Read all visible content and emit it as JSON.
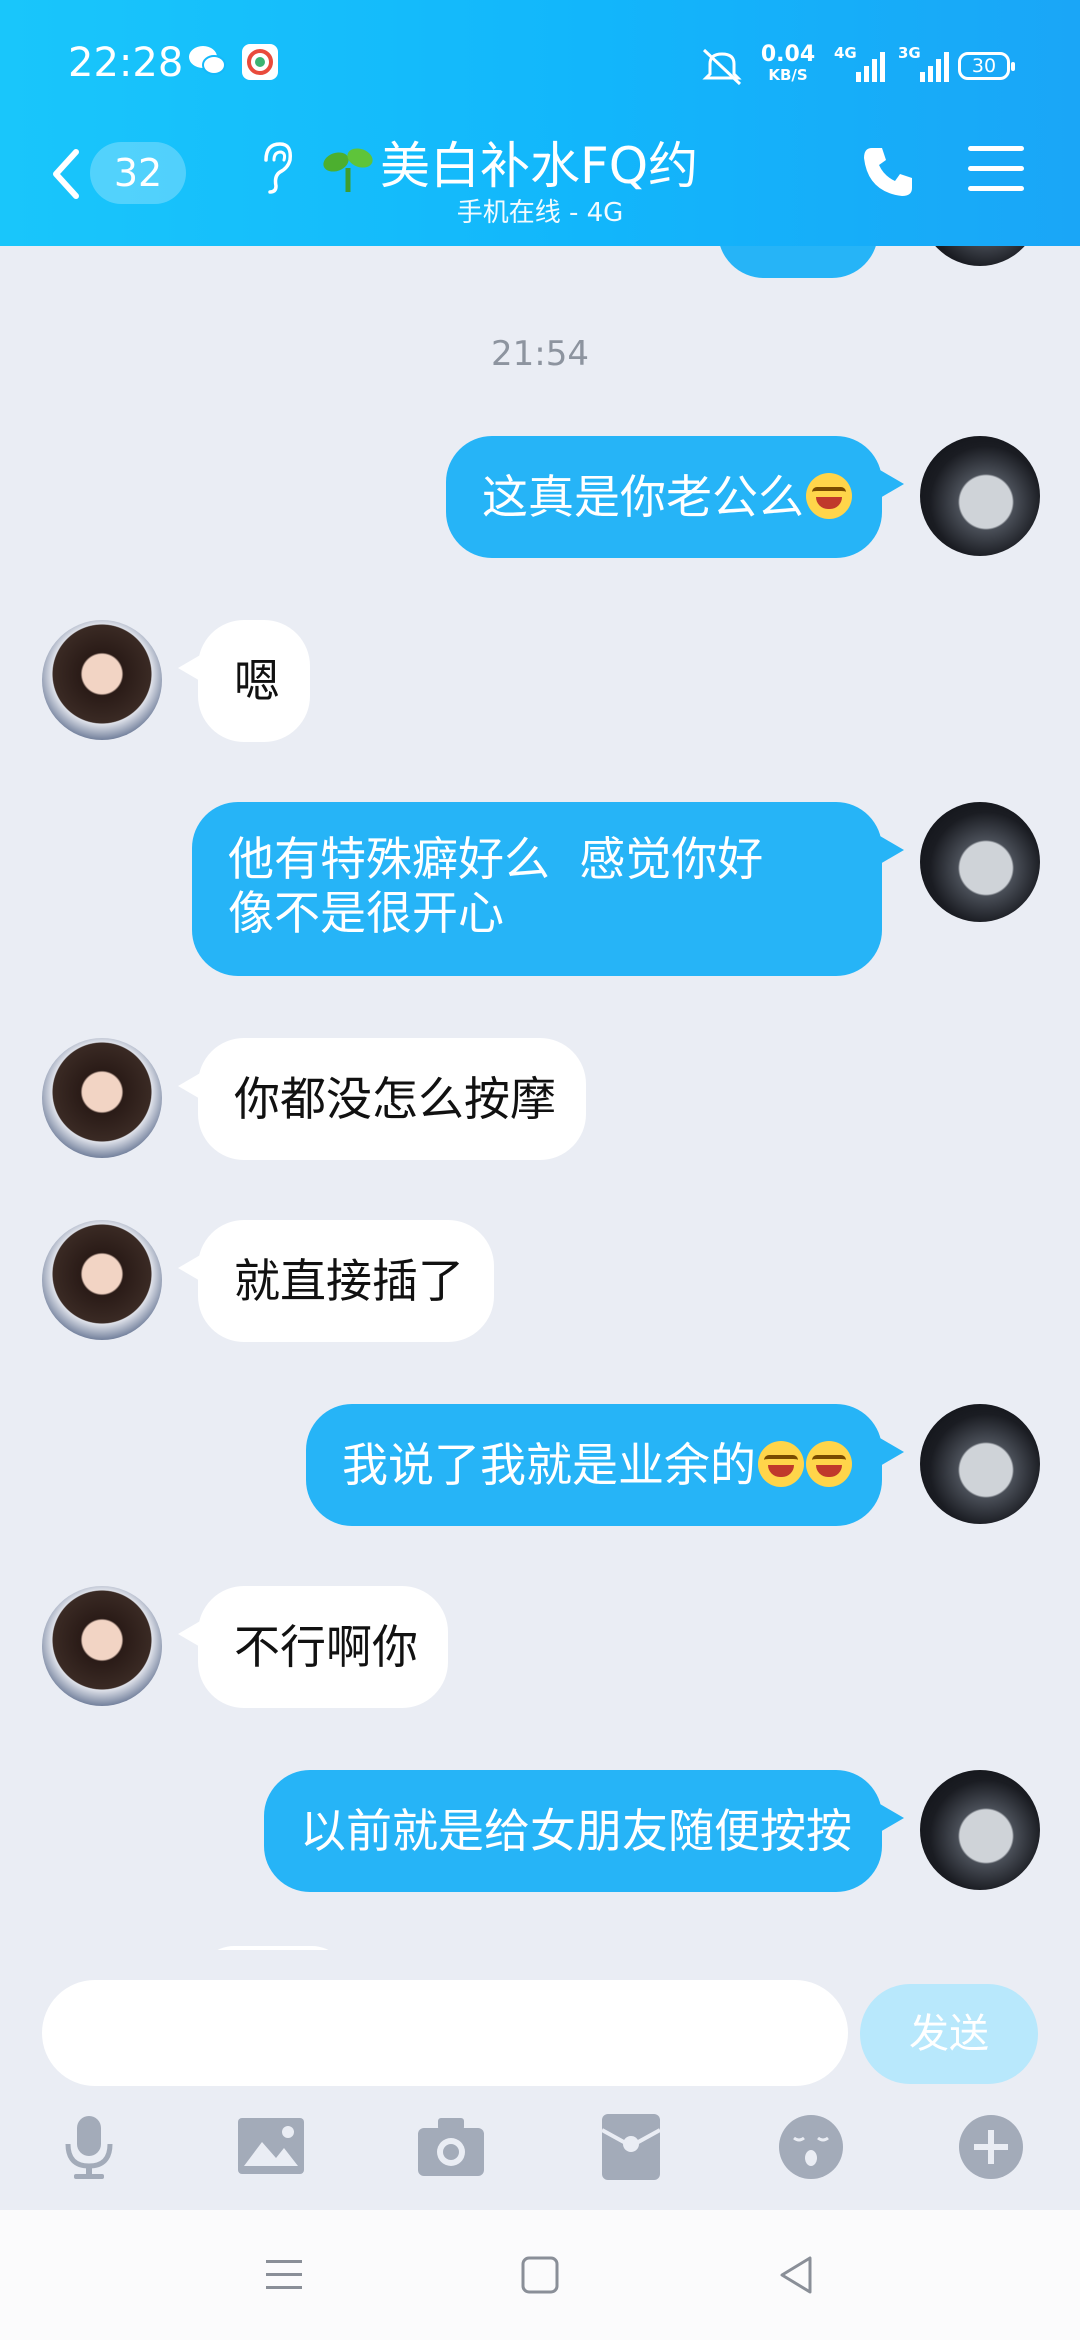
{
  "status_bar": {
    "time": "22:28",
    "net_speed_value": "0.04",
    "net_speed_unit": "KB/S",
    "signal1_label": "4G",
    "signal2_label": "3G",
    "battery": "30"
  },
  "header": {
    "unread_count": "32",
    "title": "美白补水FQ约",
    "subtitle": "手机在线 - 4G"
  },
  "messages": [
    {
      "side": "self",
      "text": "这真是你老公么"
    },
    {
      "side": "other",
      "text": "嗯"
    },
    {
      "side": "self",
      "text": "他有特殊癖好么  感觉你好\n像不是很开心"
    },
    {
      "side": "other",
      "text": "你都没怎么按摩"
    },
    {
      "side": "other",
      "text": "就直接插了"
    },
    {
      "side": "self",
      "text": "我说了我就是业余的"
    },
    {
      "side": "other",
      "text": "不行啊你"
    },
    {
      "side": "self",
      "text": "以前就是给女朋友随便按按"
    }
  ],
  "timestamp": "21:54",
  "input": {
    "value": "",
    "send_label": "发送"
  },
  "toolbar": [
    "microphone-icon",
    "image-icon",
    "camera-icon",
    "red-packet-icon",
    "emoji-icon",
    "plus-icon"
  ],
  "colors": {
    "header_start": "#19c6fb",
    "header_end": "#1aa6f7",
    "self_bubble": "#26b4f7",
    "other_bubble": "#ffffff",
    "background": "#eaedf4",
    "send_button": "#b8e8fc"
  }
}
